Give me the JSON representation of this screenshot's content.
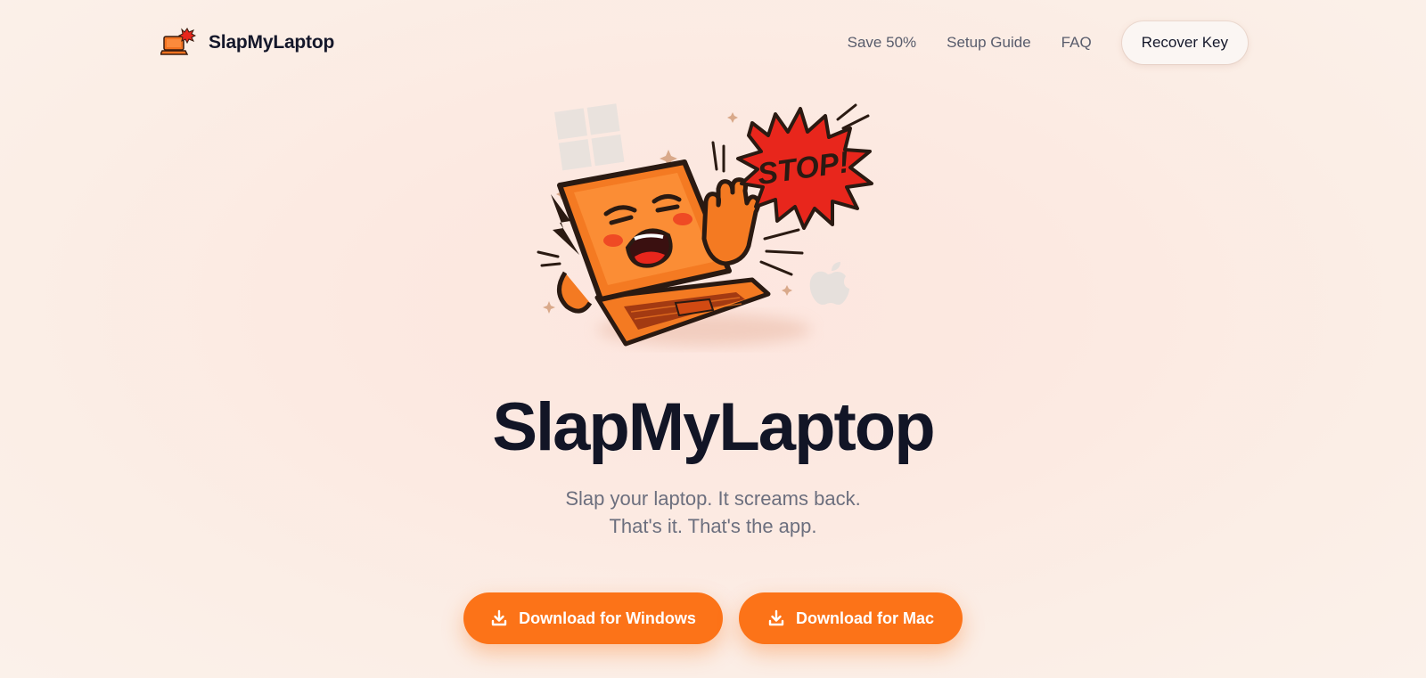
{
  "brand": {
    "name": "SlapMyLaptop",
    "logo_icon": "laptop-stop-logo-icon"
  },
  "nav": {
    "links": [
      {
        "label": "Save 50%"
      },
      {
        "label": "Setup Guide"
      },
      {
        "label": "FAQ"
      }
    ],
    "recover_label": "Recover Key"
  },
  "hero": {
    "illustration": {
      "bubble_text": "STOP!",
      "icons": [
        "windows-icon",
        "apple-icon",
        "angry-laptop-icon",
        "stop-speech-bubble-icon"
      ]
    },
    "title": "SlapMyLaptop",
    "subtitle_line1": "Slap your laptop. It screams back.",
    "subtitle_line2": "That's it. That's the app."
  },
  "cta": {
    "windows_label": "Download for Windows",
    "mac_label": "Download for Mac",
    "icon": "download-icon"
  },
  "colors": {
    "accent": "#fc7318",
    "text_dark": "#14172a",
    "text_muted": "#6c6f7e",
    "bubble_red": "#e8261c"
  }
}
